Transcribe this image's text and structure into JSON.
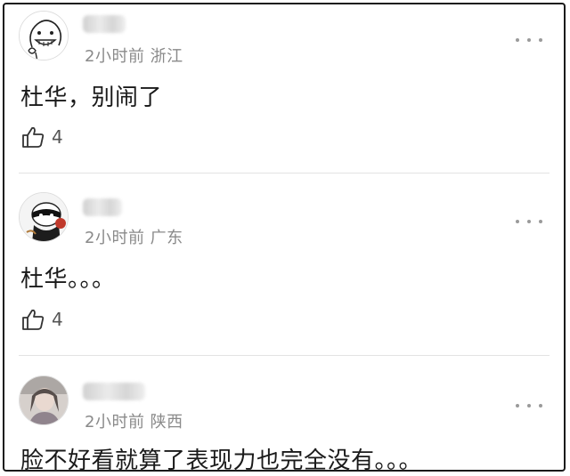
{
  "comments": [
    {
      "time_location": "2小时前 浙江",
      "text": "杜华，别闹了",
      "likes": "4",
      "avatar": "cartoon-grin-avatar"
    },
    {
      "time_location": "2小时前 广东",
      "text": "杜华。。。",
      "likes": "4",
      "avatar": "cartoon-bandit-avatar"
    },
    {
      "time_location": "2小时前 陕西",
      "text": "脸不好看就算了表现力也完全没有。。。",
      "avatar": "photo-avatar"
    }
  ],
  "icons": {
    "like": "thumbs-up-icon",
    "more": "more-dots-icon"
  },
  "colors": {
    "border": "#1a1a1a",
    "meta_text": "#8a8a8a",
    "body_text": "#1a1a1a",
    "divider": "#e3e3e3"
  }
}
